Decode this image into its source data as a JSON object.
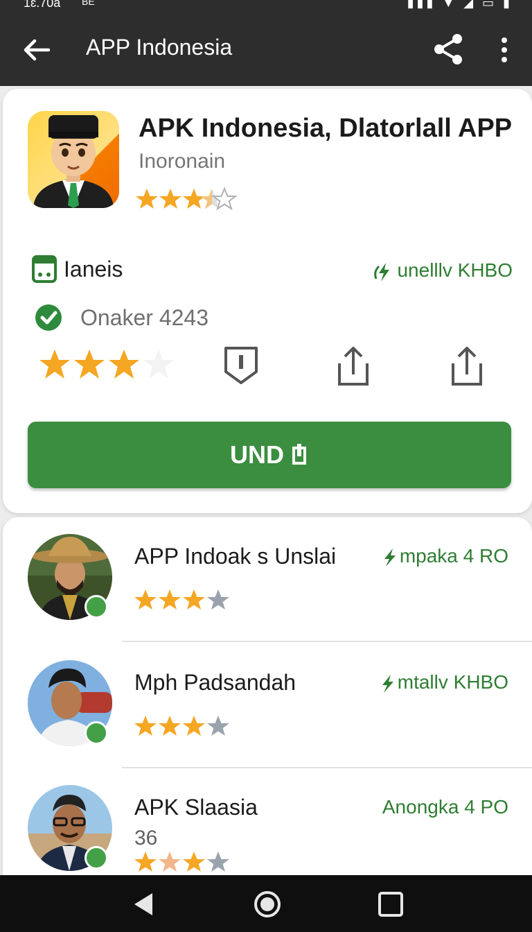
{
  "status_bar": {
    "time": "1ɛ.70a",
    "indicator": "BE",
    "icons_right": "▮▮▮ ▼ ◢ ▭ ▮"
  },
  "app_bar": {
    "title": "APP Indonesia",
    "back_icon": "arrow-left",
    "share_icon": "share",
    "more_icon": "more-vertical"
  },
  "app": {
    "name": "APK Indonesia, Dlatorlall APP",
    "developer": "Inoronain",
    "header_rating": 3.5,
    "category_label": "Ianeis",
    "category_meta": "unelllv KHBO",
    "verified_label": "Onaker 4243",
    "user_rating": 3,
    "install_label": "UND"
  },
  "list": [
    {
      "name": "APP Indoak s Unslai",
      "meta": "mpaka 4 RO",
      "rating": 3.5
    },
    {
      "name": "Mph Padsandah",
      "meta": "mtallv KHBO",
      "rating": 3.5
    },
    {
      "name": "APK Slaasia",
      "sub": "36",
      "meta": "Anongka 4 PO",
      "rating": 3.5
    }
  ],
  "colors": {
    "accent": "#3b8e3f",
    "star": "#f5a623",
    "star_empty": "#9aa3ad",
    "appbar": "#2d2d2d"
  }
}
